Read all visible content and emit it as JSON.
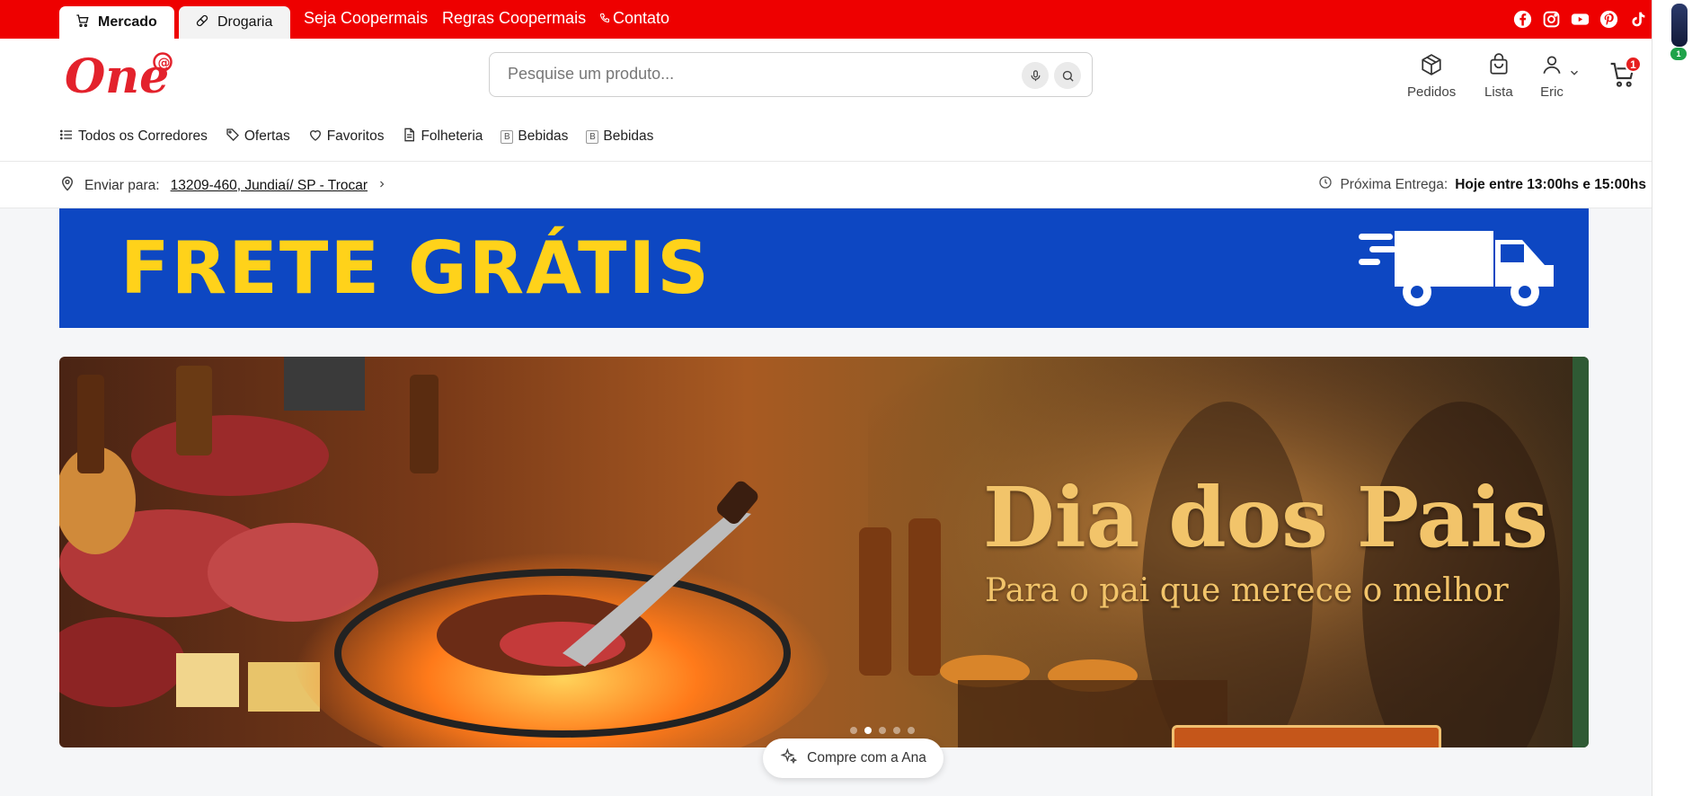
{
  "top_bar": {
    "store_tabs": [
      {
        "label": "Mercado",
        "icon": "cart-icon",
        "active": true
      },
      {
        "label": "Drogaria",
        "icon": "pill-icon",
        "active": false
      }
    ],
    "links": [
      "Seja Coopermais",
      "Regras Coopermais",
      "Contato"
    ],
    "social_icons": [
      "facebook-icon",
      "instagram-icon",
      "youtube-icon",
      "pinterest-icon",
      "tiktok-icon"
    ],
    "color": "#ee0000"
  },
  "header": {
    "logo_text": "One",
    "search": {
      "placeholder": "Pesquise um produto..."
    },
    "actions": [
      {
        "label": "Pedidos",
        "icon": "box-icon"
      },
      {
        "label": "Lista",
        "icon": "bag-icon"
      },
      {
        "label": "Eric",
        "icon": "user-icon"
      }
    ],
    "cart_count": "1"
  },
  "nav": {
    "items": [
      {
        "label": "Todos os Corredores",
        "icon": "list-icon"
      },
      {
        "label": "Ofertas",
        "icon": "tag-icon"
      },
      {
        "label": "Favoritos",
        "icon": "heart-icon"
      },
      {
        "label": "Folheteria",
        "icon": "document-icon"
      },
      {
        "label": "Bebidas",
        "icon": "broken-image-icon",
        "alt": "B"
      },
      {
        "label": "Bebidas",
        "icon": "broken-image-icon",
        "alt": "B"
      }
    ]
  },
  "delivery": {
    "label": "Enviar para:",
    "address": "13209-460, Jundiaí/ SP - Trocar",
    "next_label": "Próxima Entrega:",
    "next_value": "Hoje entre 13:00hs e 15:00hs"
  },
  "banners": {
    "frete": {
      "text": "FRETE GRÁTIS",
      "bg": "#0d47c2",
      "text_color": "#ffd21a"
    },
    "hero": {
      "title": "Dia dos Pais",
      "subtitle": "Para o pai que merece o melhor",
      "slide_count": 5,
      "active_slide": 2
    }
  },
  "assistant": {
    "label": "Compre com a Ana",
    "icon": "sparkle-icon"
  },
  "extension": {
    "badge": "1"
  }
}
